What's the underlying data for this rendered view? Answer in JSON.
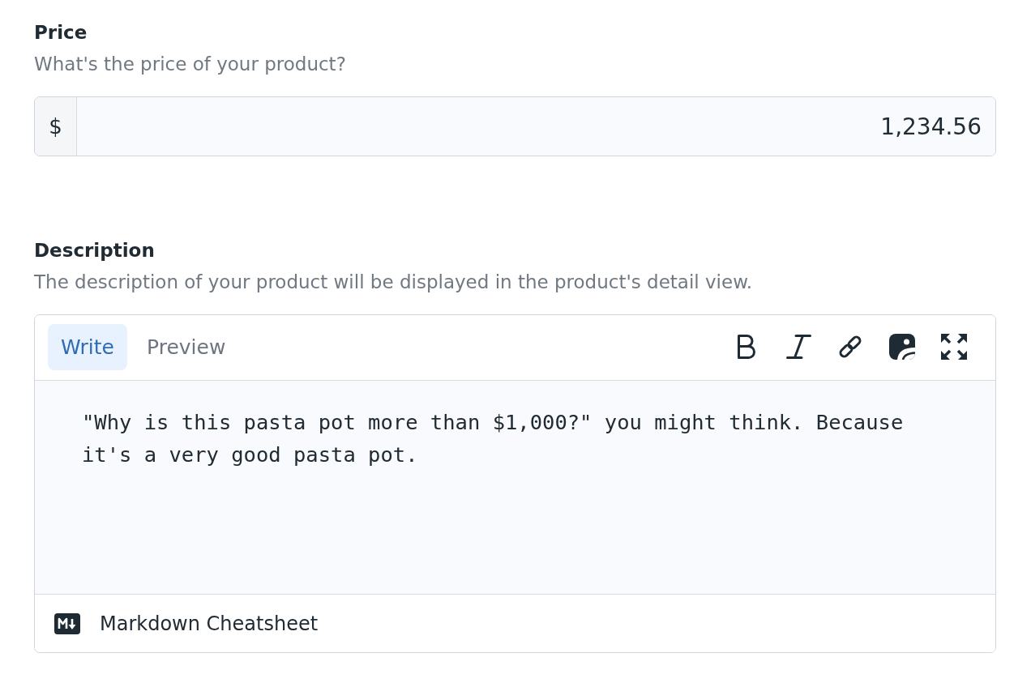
{
  "fields": [
    {
      "kind": "price",
      "label": "Price",
      "description": "What's the price of your product?",
      "prefix": "$",
      "value": "1,234.56"
    },
    {
      "kind": "markdown",
      "label": "Description",
      "description": "The description of your product will be displayed in the product's detail view.",
      "tabs": [
        {
          "label": "Write",
          "selected": true
        },
        {
          "label": "Preview",
          "selected": false
        }
      ],
      "value": "\"Why is this pasta pot more than $1,000?\" you might think. Because it's a very good pasta pot.",
      "footer_link": "Markdown Cheatsheet"
    }
  ]
}
